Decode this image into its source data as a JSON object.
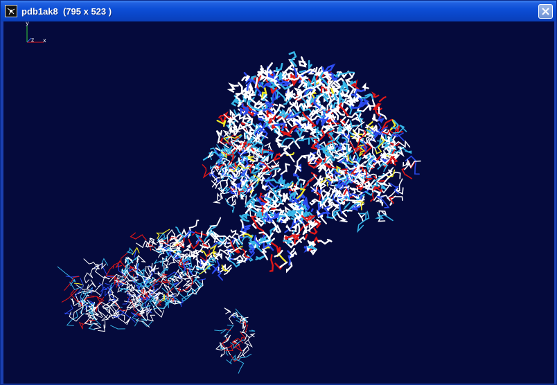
{
  "window": {
    "title": "pdb1ak8  (795 x 523 )",
    "app_icon": "molecule-app-icon",
    "close_icon": "close-icon"
  },
  "axes": {
    "x_label": "x",
    "y_label": "y",
    "z_label": "z"
  },
  "colors": {
    "viewport_background": "#050a3c",
    "carbon_main": "#ffffff",
    "carbon_alt": "#37b6e8",
    "nitrogen": "#2c4cf0",
    "oxygen": "#e01818",
    "sulfur": "#f2ea2a"
  }
}
